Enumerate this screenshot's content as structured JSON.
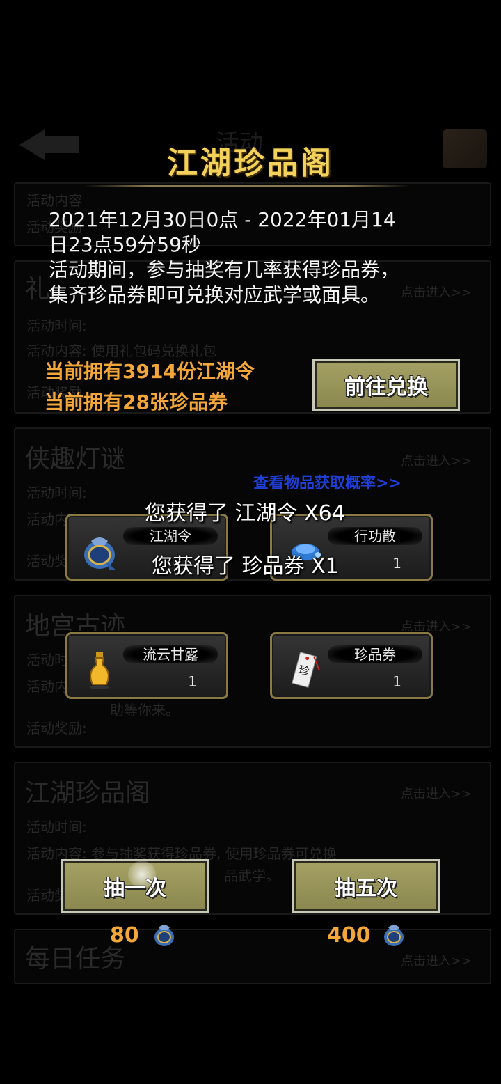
{
  "background": {
    "top_word": "活动",
    "cards": [
      {
        "title": "",
        "goto": "",
        "lines": [
          "活动内容",
          "活动奖励"
        ]
      },
      {
        "title": "礼",
        "goto": "点击进入>>",
        "lines": [
          "活动时间:",
          "活动内容: 使用礼包码兑换礼包",
          "活动奖励"
        ]
      },
      {
        "title": "侠趣灯谜",
        "goto": "点击进入>>",
        "lines": [
          "活动时间:",
          "活动内容",
          "活动奖励"
        ]
      },
      {
        "title": "地宫古迹",
        "goto": "点击进入>>",
        "lines": [
          "活动时间",
          "活动内容",
          "助等你来。",
          "活动奖励:"
        ]
      },
      {
        "title": "江湖珍品阁",
        "goto": "点击进入>>",
        "lines": [
          "活动时间:",
          "活动内容: 参与抽奖获得珍品券, 使用珍品券可兑换",
          "品武学。",
          "活动奖励"
        ]
      },
      {
        "title": "每日任务",
        "goto": "点击进入>>",
        "lines": []
      }
    ]
  },
  "modal": {
    "title": "江湖珍品阁",
    "description_lines": [
      "2021年12月30日0点 - 2022年01月14",
      "日23点59分59秒",
      "活动期间，参与抽奖有几率获得珍品券，",
      "集齐珍品券即可兑换对应武学或面具。"
    ],
    "owned_tokens": "当前拥有3914份江湖令",
    "owned_tickets": "当前拥有28张珍品券",
    "exchange_button": "前往兑换",
    "rate_link": "查看物品获取概率>>",
    "prizes": [
      {
        "name": "江湖令",
        "count": "",
        "icon": "pouch-icon"
      },
      {
        "name": "行功散",
        "count": "1",
        "icon": "blue-powder-icon"
      },
      {
        "name": "流云甘露",
        "count": "1",
        "icon": "gold-vase-icon"
      },
      {
        "name": "珍品券",
        "count": "1",
        "icon": "ticket-icon"
      }
    ],
    "toast_1": "您获得了 江湖令 X64",
    "toast_2": "您获得了 珍品券 X1",
    "draw_once": "抽一次",
    "draw_five": "抽五次",
    "cost_once": "80",
    "cost_five": "400",
    "colors": {
      "title": "#f2d25a",
      "owned": "#f3a73a",
      "button": "#9a965a",
      "link": "#1f3fd8"
    }
  }
}
